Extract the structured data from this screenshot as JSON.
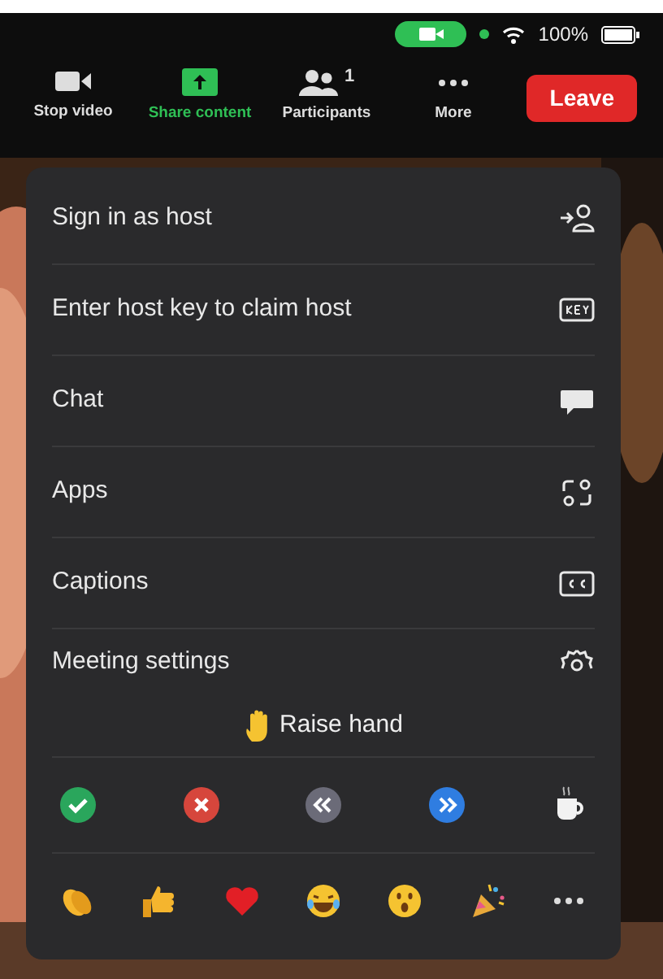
{
  "status_bar": {
    "battery": "100%"
  },
  "toolbar": {
    "items": [
      {
        "label": "Stop video",
        "kind": "video",
        "active": false
      },
      {
        "label": "Share content",
        "kind": "share",
        "active": true
      },
      {
        "label": "Participants",
        "kind": "participants",
        "active": false,
        "count": "1"
      },
      {
        "label": "More",
        "kind": "more",
        "active": false
      }
    ],
    "leave": "Leave"
  },
  "menu": {
    "items": [
      {
        "label": "Sign in as host",
        "kind": "sign-in"
      },
      {
        "label": "Enter host key to claim host",
        "kind": "key"
      },
      {
        "label": "Chat",
        "kind": "chat"
      },
      {
        "label": "Apps",
        "kind": "apps"
      },
      {
        "label": "Captions",
        "kind": "captions"
      },
      {
        "label": "Meeting settings",
        "kind": "settings"
      }
    ],
    "raise_hand": "Raise hand",
    "feedback": [
      {
        "kind": "yes"
      },
      {
        "kind": "no"
      },
      {
        "kind": "slower"
      },
      {
        "kind": "faster"
      },
      {
        "kind": "coffee"
      }
    ],
    "reactions": [
      {
        "kind": "clap"
      },
      {
        "kind": "thumbs-up"
      },
      {
        "kind": "heart"
      },
      {
        "kind": "laugh"
      },
      {
        "kind": "surprised"
      },
      {
        "kind": "party"
      },
      {
        "kind": "more"
      }
    ]
  }
}
